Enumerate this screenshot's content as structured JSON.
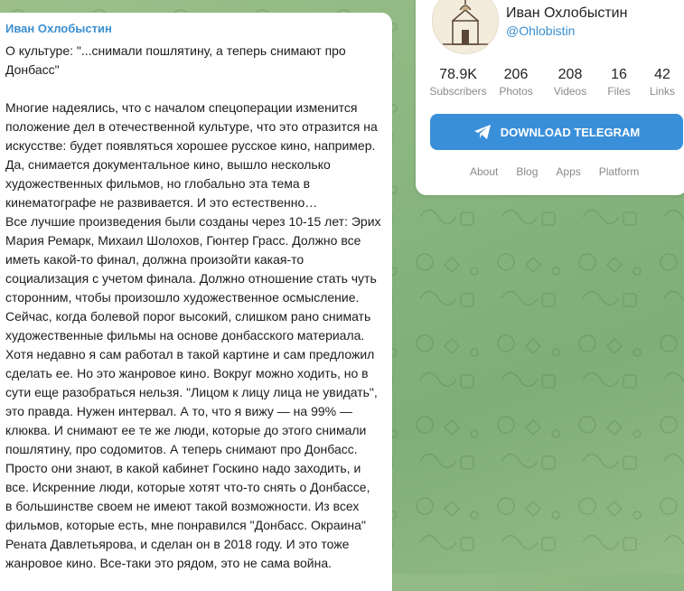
{
  "post": {
    "author": "Иван Охлобыстин",
    "paragraph_1": "О культуре: \"...снимали пошлятину, а теперь снимают про\nДонбасс\"",
    "paragraph_2": "Многие надеялись, что с началом спецоперации изменится\nположение дел в отечественной культуре, что это отразится на\nискусстве: будет появляться хорошее русское кино, например.\nДа, снимается документальное кино, вышло несколько\nхудожественных фильмов, но глобально эта тема в\nкинематографе не развивается. И это естественно…\nВсе лучшие произведения были созданы через 10-15 лет: Эрих\nМария Ремарк, Михаил Шолохов, Гюнтер Грасс. Должно все\nиметь какой-то финал, должна произойти какая-то\nсоциализация с учетом финала. Должно отношение стать чуть\nсторонним, чтобы произошло художественное осмысление.\nСейчас, когда болевой порог высокий, слишком рано снимать\nхудожественные фильмы на основе донбасского материала.\nХотя недавно я сам работал в такой картине и сам предложил\nсделать ее. Но это жанровое кино. Вокруг можно ходить, но в\nсути еще разобраться нельзя. \"Лицом к лицу лица не увидать\",\nэто правда. Нужен интервал. А то, что я вижу — на 99% —\nклюква. И снимают ее те же люди, которые до этого снимали\nпошлятину, про содомитов. А теперь снимают про Донбасс.\nПросто они знают, в какой кабинет Госкино надо заходить, и\nвсе. Искренние люди, которые хотят что-то снять о Донбассе,\nв большинстве своем не имеют такой возможности. Из всех\nфильмов, которые есть, мне понравился \"Донбасс. Окраина\"\nРената Давлетьярова, и сделан он в 2018 году. И это тоже\nжанровое кино. Все-таки это рядом, это не сама война."
  },
  "channel": {
    "name": "Иван Охлобыстин",
    "handle": "@Ohlobistin",
    "counters": [
      {
        "value": "78.9K",
        "label": "Subscribers"
      },
      {
        "value": "206",
        "label": "Photos"
      },
      {
        "value": "208",
        "label": "Videos"
      },
      {
        "value": "16",
        "label": "Files"
      },
      {
        "value": "42",
        "label": "Links"
      }
    ],
    "download_label": "DOWNLOAD TELEGRAM",
    "footer_links": [
      "About",
      "Blog",
      "Apps",
      "Platform"
    ]
  },
  "colors": {
    "accent": "#3a8fd9",
    "link": "#3a8fd0",
    "background": "#8fb883"
  }
}
